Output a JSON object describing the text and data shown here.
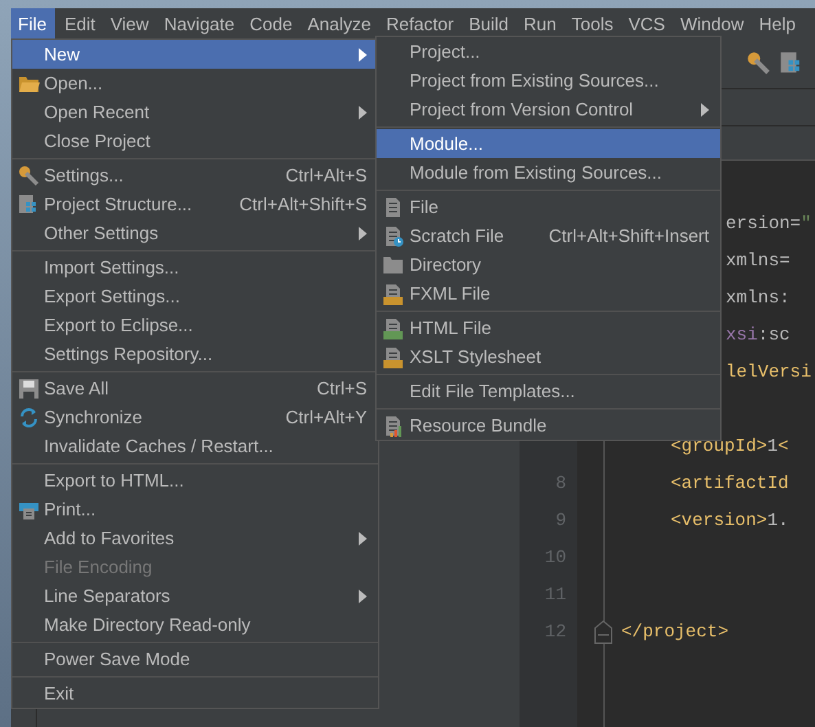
{
  "menu_bar": [
    {
      "label": "File",
      "selected": true
    },
    {
      "label": "Edit",
      "selected": false
    },
    {
      "label": "View",
      "selected": false
    },
    {
      "label": "Navigate",
      "selected": false
    },
    {
      "label": "Code",
      "selected": false
    },
    {
      "label": "Analyze",
      "selected": false
    },
    {
      "label": "Refactor",
      "selected": false
    },
    {
      "label": "Build",
      "selected": false
    },
    {
      "label": "Run",
      "selected": false
    },
    {
      "label": "Tools",
      "selected": false
    },
    {
      "label": "VCS",
      "selected": false
    },
    {
      "label": "Window",
      "selected": false
    },
    {
      "label": "Help",
      "selected": false
    }
  ],
  "file_menu": [
    {
      "kind": "item",
      "label": "New",
      "submenu": true,
      "selected": true,
      "disabled": false
    },
    {
      "kind": "item",
      "label": "Open...",
      "selected": false,
      "disabled": false
    },
    {
      "kind": "item",
      "label": "Open Recent",
      "submenu": true,
      "selected": false,
      "disabled": false
    },
    {
      "kind": "item",
      "label": "Close Project",
      "selected": false,
      "disabled": false
    },
    {
      "kind": "separator"
    },
    {
      "kind": "item",
      "label": "Settings...",
      "shortcut": "Ctrl+Alt+S",
      "selected": false,
      "disabled": false
    },
    {
      "kind": "item",
      "label": "Project Structure...",
      "shortcut": "Ctrl+Alt+Shift+S",
      "selected": false,
      "disabled": false
    },
    {
      "kind": "item",
      "label": "Other Settings",
      "submenu": true,
      "selected": false,
      "disabled": false
    },
    {
      "kind": "separator"
    },
    {
      "kind": "item",
      "label": "Import Settings...",
      "selected": false,
      "disabled": false
    },
    {
      "kind": "item",
      "label": "Export Settings...",
      "selected": false,
      "disabled": false
    },
    {
      "kind": "item",
      "label": "Export to Eclipse...",
      "selected": false,
      "disabled": false
    },
    {
      "kind": "item",
      "label": "Settings Repository...",
      "selected": false,
      "disabled": false
    },
    {
      "kind": "separator"
    },
    {
      "kind": "item",
      "label": "Save All",
      "shortcut": "Ctrl+S",
      "selected": false,
      "disabled": false
    },
    {
      "kind": "item",
      "label": "Synchronize",
      "shortcut": "Ctrl+Alt+Y",
      "selected": false,
      "disabled": false
    },
    {
      "kind": "item",
      "label": "Invalidate Caches / Restart...",
      "selected": false,
      "disabled": false
    },
    {
      "kind": "separator"
    },
    {
      "kind": "item",
      "label": "Export to HTML...",
      "selected": false,
      "disabled": false
    },
    {
      "kind": "item",
      "label": "Print...",
      "selected": false,
      "disabled": false
    },
    {
      "kind": "item",
      "label": "Add to Favorites",
      "submenu": true,
      "selected": false,
      "disabled": false
    },
    {
      "kind": "item",
      "label": "File Encoding",
      "selected": false,
      "disabled": true
    },
    {
      "kind": "item",
      "label": "Line Separators",
      "submenu": true,
      "selected": false,
      "disabled": false
    },
    {
      "kind": "item",
      "label": "Make Directory Read-only",
      "selected": false,
      "disabled": false
    },
    {
      "kind": "separator"
    },
    {
      "kind": "item",
      "label": "Power Save Mode",
      "selected": false,
      "disabled": false
    },
    {
      "kind": "separator"
    },
    {
      "kind": "item",
      "label": "Exit",
      "selected": false,
      "disabled": false
    }
  ],
  "new_submenu": [
    {
      "kind": "item",
      "label": "Project...",
      "selected": false
    },
    {
      "kind": "item",
      "label": "Project from Existing Sources...",
      "selected": false
    },
    {
      "kind": "item",
      "label": "Project from Version Control",
      "submenu": true,
      "selected": false
    },
    {
      "kind": "separator"
    },
    {
      "kind": "item",
      "label": "Module...",
      "selected": true
    },
    {
      "kind": "item",
      "label": "Module from Existing Sources...",
      "selected": false
    },
    {
      "kind": "separator"
    },
    {
      "kind": "item",
      "label": "File",
      "selected": false
    },
    {
      "kind": "item",
      "label": "Scratch File",
      "shortcut": "Ctrl+Alt+Shift+Insert",
      "selected": false
    },
    {
      "kind": "item",
      "label": "Directory",
      "selected": false
    },
    {
      "kind": "item",
      "label": "FXML File",
      "selected": false
    },
    {
      "kind": "separator"
    },
    {
      "kind": "item",
      "label": "HTML File",
      "selected": false
    },
    {
      "kind": "item",
      "label": "XSLT Stylesheet",
      "selected": false
    },
    {
      "kind": "separator"
    },
    {
      "kind": "item",
      "label": "Edit File Templates...",
      "selected": false
    },
    {
      "kind": "separator"
    },
    {
      "kind": "item",
      "label": "Resource Bundle",
      "selected": false
    }
  ],
  "editor": {
    "top_lines": [
      {
        "code": [
          {
            "kind": "attr",
            "text": "ersion="
          },
          {
            "kind": "string",
            "text": "\""
          }
        ]
      },
      {
        "code": [
          {
            "kind": "attr",
            "text": "xmlns="
          }
        ]
      },
      {
        "code": [
          {
            "kind": "attr",
            "text": "xmlns:"
          }
        ]
      },
      {
        "code": [
          {
            "kind": "ns",
            "text": "xsi"
          },
          {
            "kind": "attr",
            "text": ":sc"
          }
        ]
      },
      {
        "code": [
          {
            "kind": "tag",
            "text": "lelVersi"
          }
        ]
      }
    ],
    "lines": [
      {
        "code": [
          {
            "kind": "tag",
            "text": "<groupId>"
          },
          {
            "kind": "text",
            "text": "1"
          },
          {
            "kind": "tag",
            "text": "<"
          }
        ]
      },
      {
        "number": "8",
        "code": [
          {
            "kind": "tag",
            "text": "<artifactId"
          }
        ]
      },
      {
        "number": "9",
        "code": [
          {
            "kind": "tag",
            "text": "<version>"
          },
          {
            "kind": "text",
            "text": "1."
          }
        ]
      },
      {
        "number": "10"
      },
      {
        "number": "11"
      },
      {
        "number": "12",
        "fold": true,
        "code": [
          {
            "kind": "tag",
            "text": "</project>"
          }
        ]
      }
    ]
  }
}
